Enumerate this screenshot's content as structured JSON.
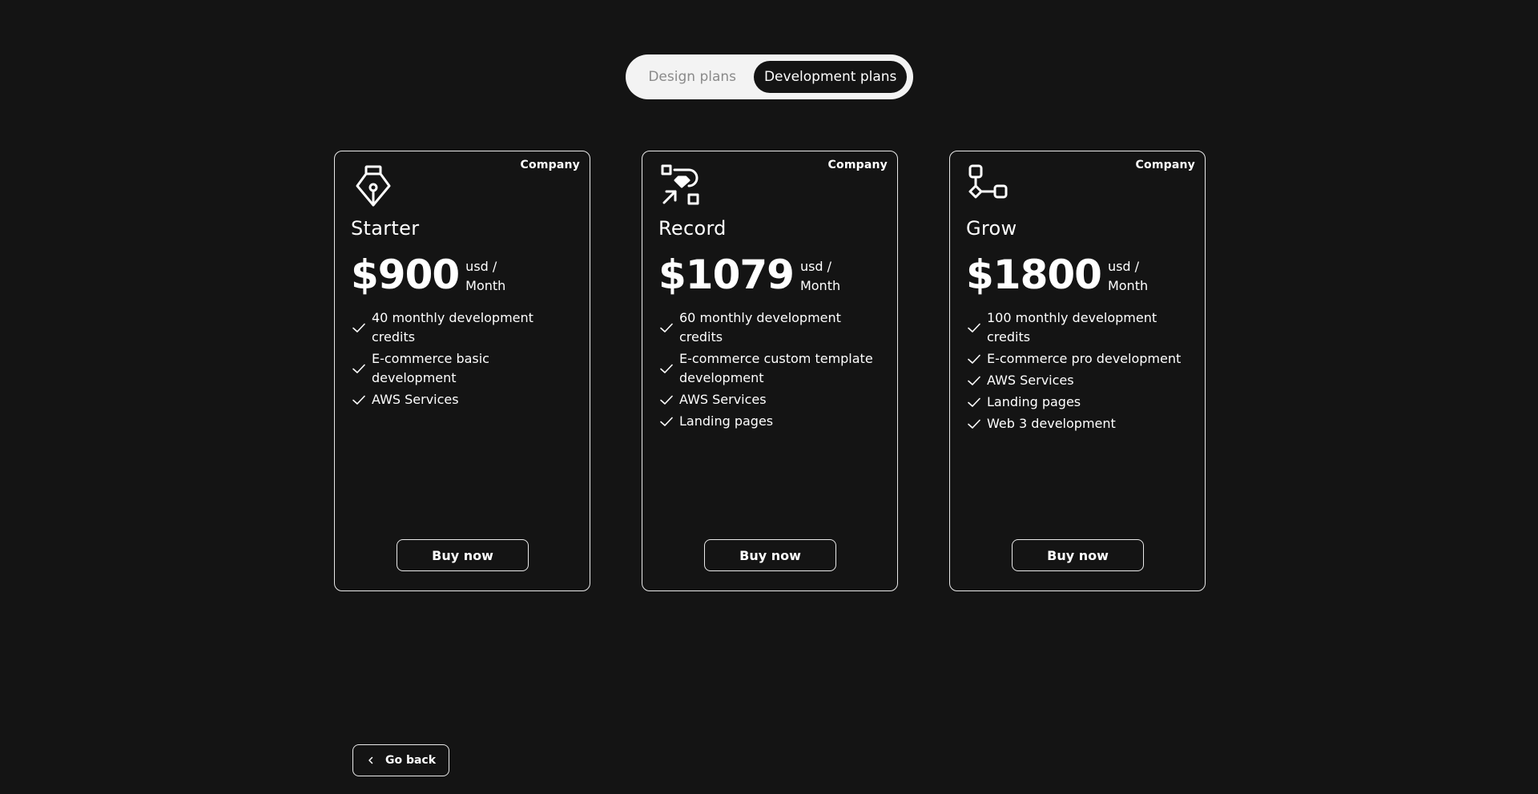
{
  "tabs": {
    "design": "Design plans",
    "development": "Development plans",
    "active": "development"
  },
  "plans": [
    {
      "badge": "Company",
      "icon": "pen-tool-icon",
      "name": "Starter",
      "price": "$900",
      "unit_line1": "usd /",
      "unit_line2": "Month",
      "features": [
        "40 monthly development credits",
        "E-commerce basic development",
        "AWS Services"
      ],
      "button": "Buy now"
    },
    {
      "badge": "Company",
      "icon": "workflow-icon",
      "name": "Record",
      "price": "$1079",
      "unit_line1": "usd /",
      "unit_line2": "Month",
      "features": [
        "60 monthly development credits",
        "E-commerce custom template development",
        "AWS Services",
        "Landing pages"
      ],
      "button": "Buy now"
    },
    {
      "badge": "Company",
      "icon": "node-tree-icon",
      "name": "Grow",
      "price": "$1800",
      "unit_line1": "usd /",
      "unit_line2": "Month",
      "features": [
        "100 monthly development credits",
        "E-commerce pro development",
        "AWS Services",
        "Landing pages",
        "Web 3 development"
      ],
      "button": "Buy now"
    }
  ],
  "go_back": {
    "label": "Go back",
    "icon": "chevron-left-icon"
  },
  "colors": {
    "background": "#141414",
    "toggle_bg": "#f3f3f3",
    "border": "#e9e9e9",
    "inactive_tab_text": "#8a8a8a"
  }
}
